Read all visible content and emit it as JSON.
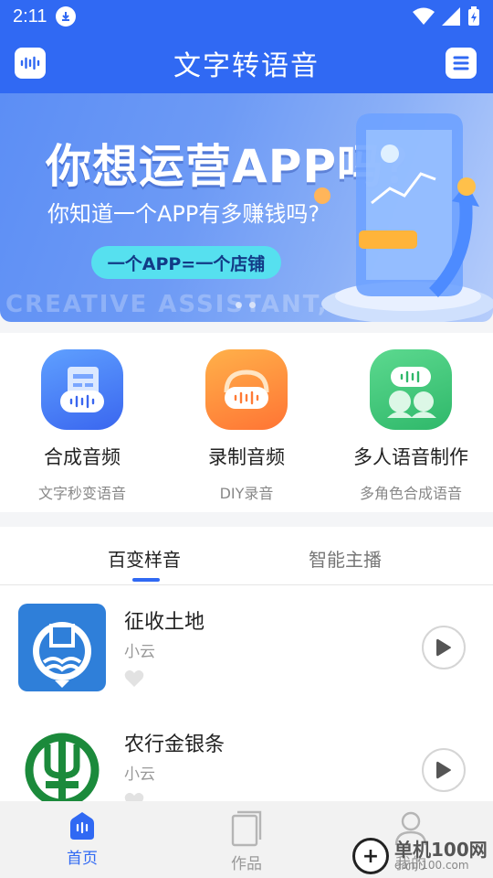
{
  "status_bar": {
    "time": "2:11"
  },
  "header": {
    "title": "文字转语音"
  },
  "banner": {
    "headline": "你想运营APP吗？",
    "subline": "你知道一个APP有多赚钱吗?",
    "pill": "一个APP=一个店铺",
    "watermark": "CREATIVE ASSISTANT, SAVE TI"
  },
  "features": [
    {
      "title": "合成音频",
      "subtitle": "文字秒变语音",
      "icon": "document-audio-icon",
      "color": "#4a7df5"
    },
    {
      "title": "录制音频",
      "subtitle": "DIY录音",
      "icon": "recorder-icon",
      "color": "#ff8a3d"
    },
    {
      "title": "多人语音制作",
      "subtitle": "多角色合成语音",
      "icon": "chat-people-icon",
      "color": "#3fca7a"
    }
  ],
  "tabs": [
    {
      "label": "百变样音",
      "active": true
    },
    {
      "label": "智能主播",
      "active": false
    }
  ],
  "list": [
    {
      "title": "征收土地",
      "author": "小云",
      "thumb": "tax-emblem-icon"
    },
    {
      "title": "农行金银条",
      "author": "小云",
      "thumb": "abc-bank-logo"
    }
  ],
  "bottom_nav": [
    {
      "label": "首页",
      "active": true
    },
    {
      "label": "作品",
      "active": false
    },
    {
      "label": "我的",
      "active": false
    }
  ],
  "watermark": {
    "brand": "单机100网",
    "url": "danji100.com"
  },
  "colors": {
    "primary": "#3069f3"
  }
}
